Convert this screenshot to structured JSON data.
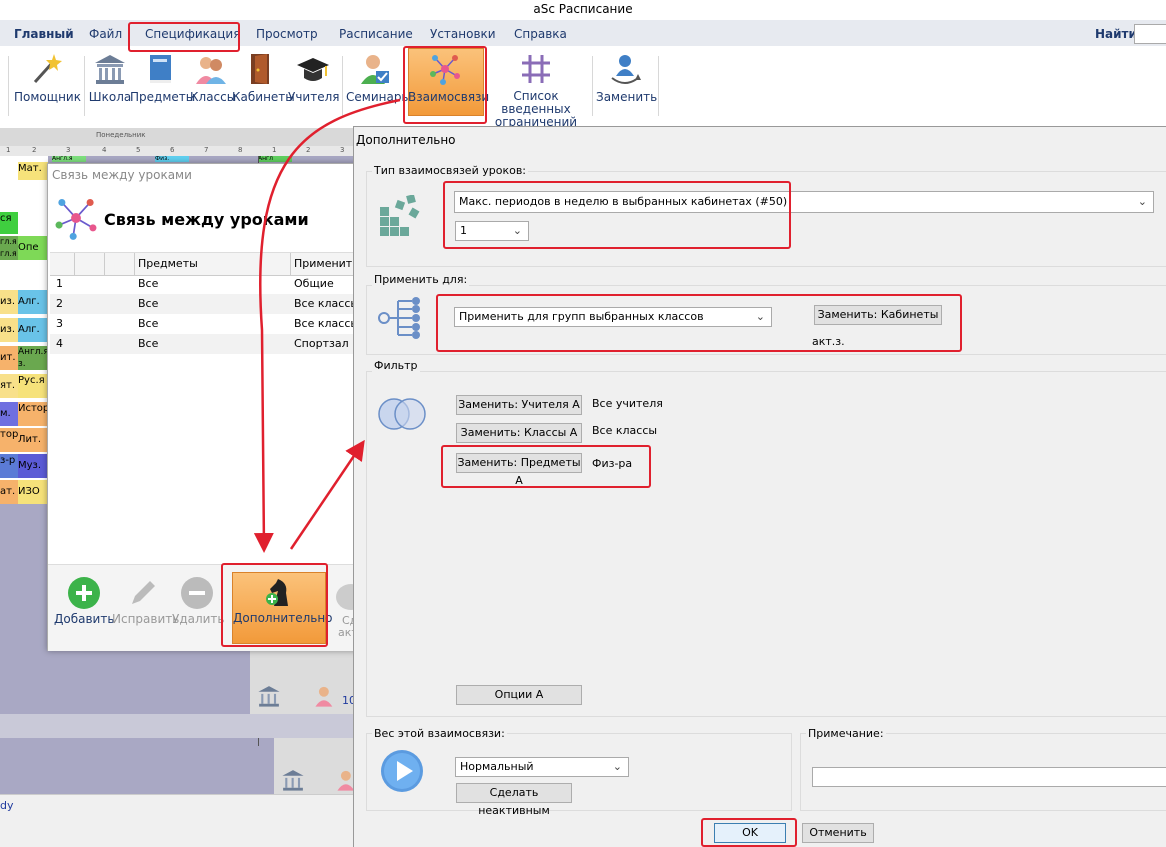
{
  "app": {
    "title": "aSc Расписание"
  },
  "menu": {
    "items": [
      "Главный",
      "Файл",
      "Спецификация",
      "Просмотр",
      "Расписание",
      "Установки",
      "Справка"
    ],
    "search_label": "Найти:"
  },
  "ribbon": {
    "buttons": [
      "Помощник",
      "Школа",
      "Предметы",
      "Классы",
      "Кабинеты",
      "Учителя",
      "Семинары",
      "Взаимосвязи",
      "Список введенных",
      "ограничений",
      "Заменить"
    ]
  },
  "background": {
    "day_header": "Понедельник",
    "period_numbers": [
      "1",
      "2",
      "3",
      "4",
      "5",
      "6",
      "7",
      "8",
      "1",
      "2",
      "3"
    ],
    "left_cells": [
      "ся",
      "гл.я",
      "гл.я",
      "Опе",
      "из.",
      "Алг.",
      "из.",
      "Алг.",
      "ит.",
      "Англ.я",
      "з.",
      "Рус.я",
      "ят.",
      "м.",
      "Истор",
      "тор",
      "Лит.",
      "з-р",
      "Муз.",
      "ат.",
      "ИЗО"
    ],
    "top_cells": [
      "Мат.",
      "Англ.я",
      "Физ.",
      "Англ"
    ],
    "bottom_number": "10",
    "status_text": "dy"
  },
  "links_dialog": {
    "window_title": "Связь между уроками",
    "heading": "Связь между уроками",
    "columns": [
      "",
      "",
      "Предметы",
      "Применить"
    ],
    "rows": [
      {
        "num": "1",
        "subjects": "Все",
        "apply": "Общие"
      },
      {
        "num": "2",
        "subjects": "Все",
        "apply": "Все классы"
      },
      {
        "num": "3",
        "subjects": "Все",
        "apply": "Все классы"
      },
      {
        "num": "4",
        "subjects": "Все",
        "apply": "Спортзал"
      }
    ],
    "buttons": {
      "add": "Добавить",
      "edit": "Исправить",
      "delete": "Удалить",
      "extra": "Дополнительно",
      "partial1": "Сд",
      "partial2": "акт"
    }
  },
  "extra_dialog": {
    "title": "Дополнительно",
    "type_group": {
      "label": "Тип взаимосвязей уроков:",
      "type_value": "Макс. периодов в неделю в выбранных кабинетах (#50)",
      "count_value": "1"
    },
    "apply_group": {
      "label": "Применить для:",
      "apply_value": "Применить для групп выбранных классов",
      "replace_button": "Заменить: Кабинеты",
      "room_value": "акт.з."
    },
    "filter_group": {
      "label": "Фильтр",
      "teachers_button": "Заменить: Учителя А",
      "teachers_value": "Все учителя",
      "classes_button": "Заменить: Классы А",
      "classes_value": "Все классы",
      "subjects_button": "Заменить: Предметы А",
      "subjects_value": "Физ-ра",
      "options_button": "Опции А"
    },
    "weight_group": {
      "label": "Вес этой взаимосвязи:",
      "weight_value": "Нормальный",
      "deactivate_button": "Сделать неактивным"
    },
    "note_group": {
      "label": "Примечание:",
      "note_value": ""
    },
    "ok_button": "OK",
    "cancel_button": "Отменить"
  },
  "colors": {
    "accent_red": "#e0202e",
    "highlight_orange": "#f7a94a",
    "add_green": "#3cb34a"
  }
}
